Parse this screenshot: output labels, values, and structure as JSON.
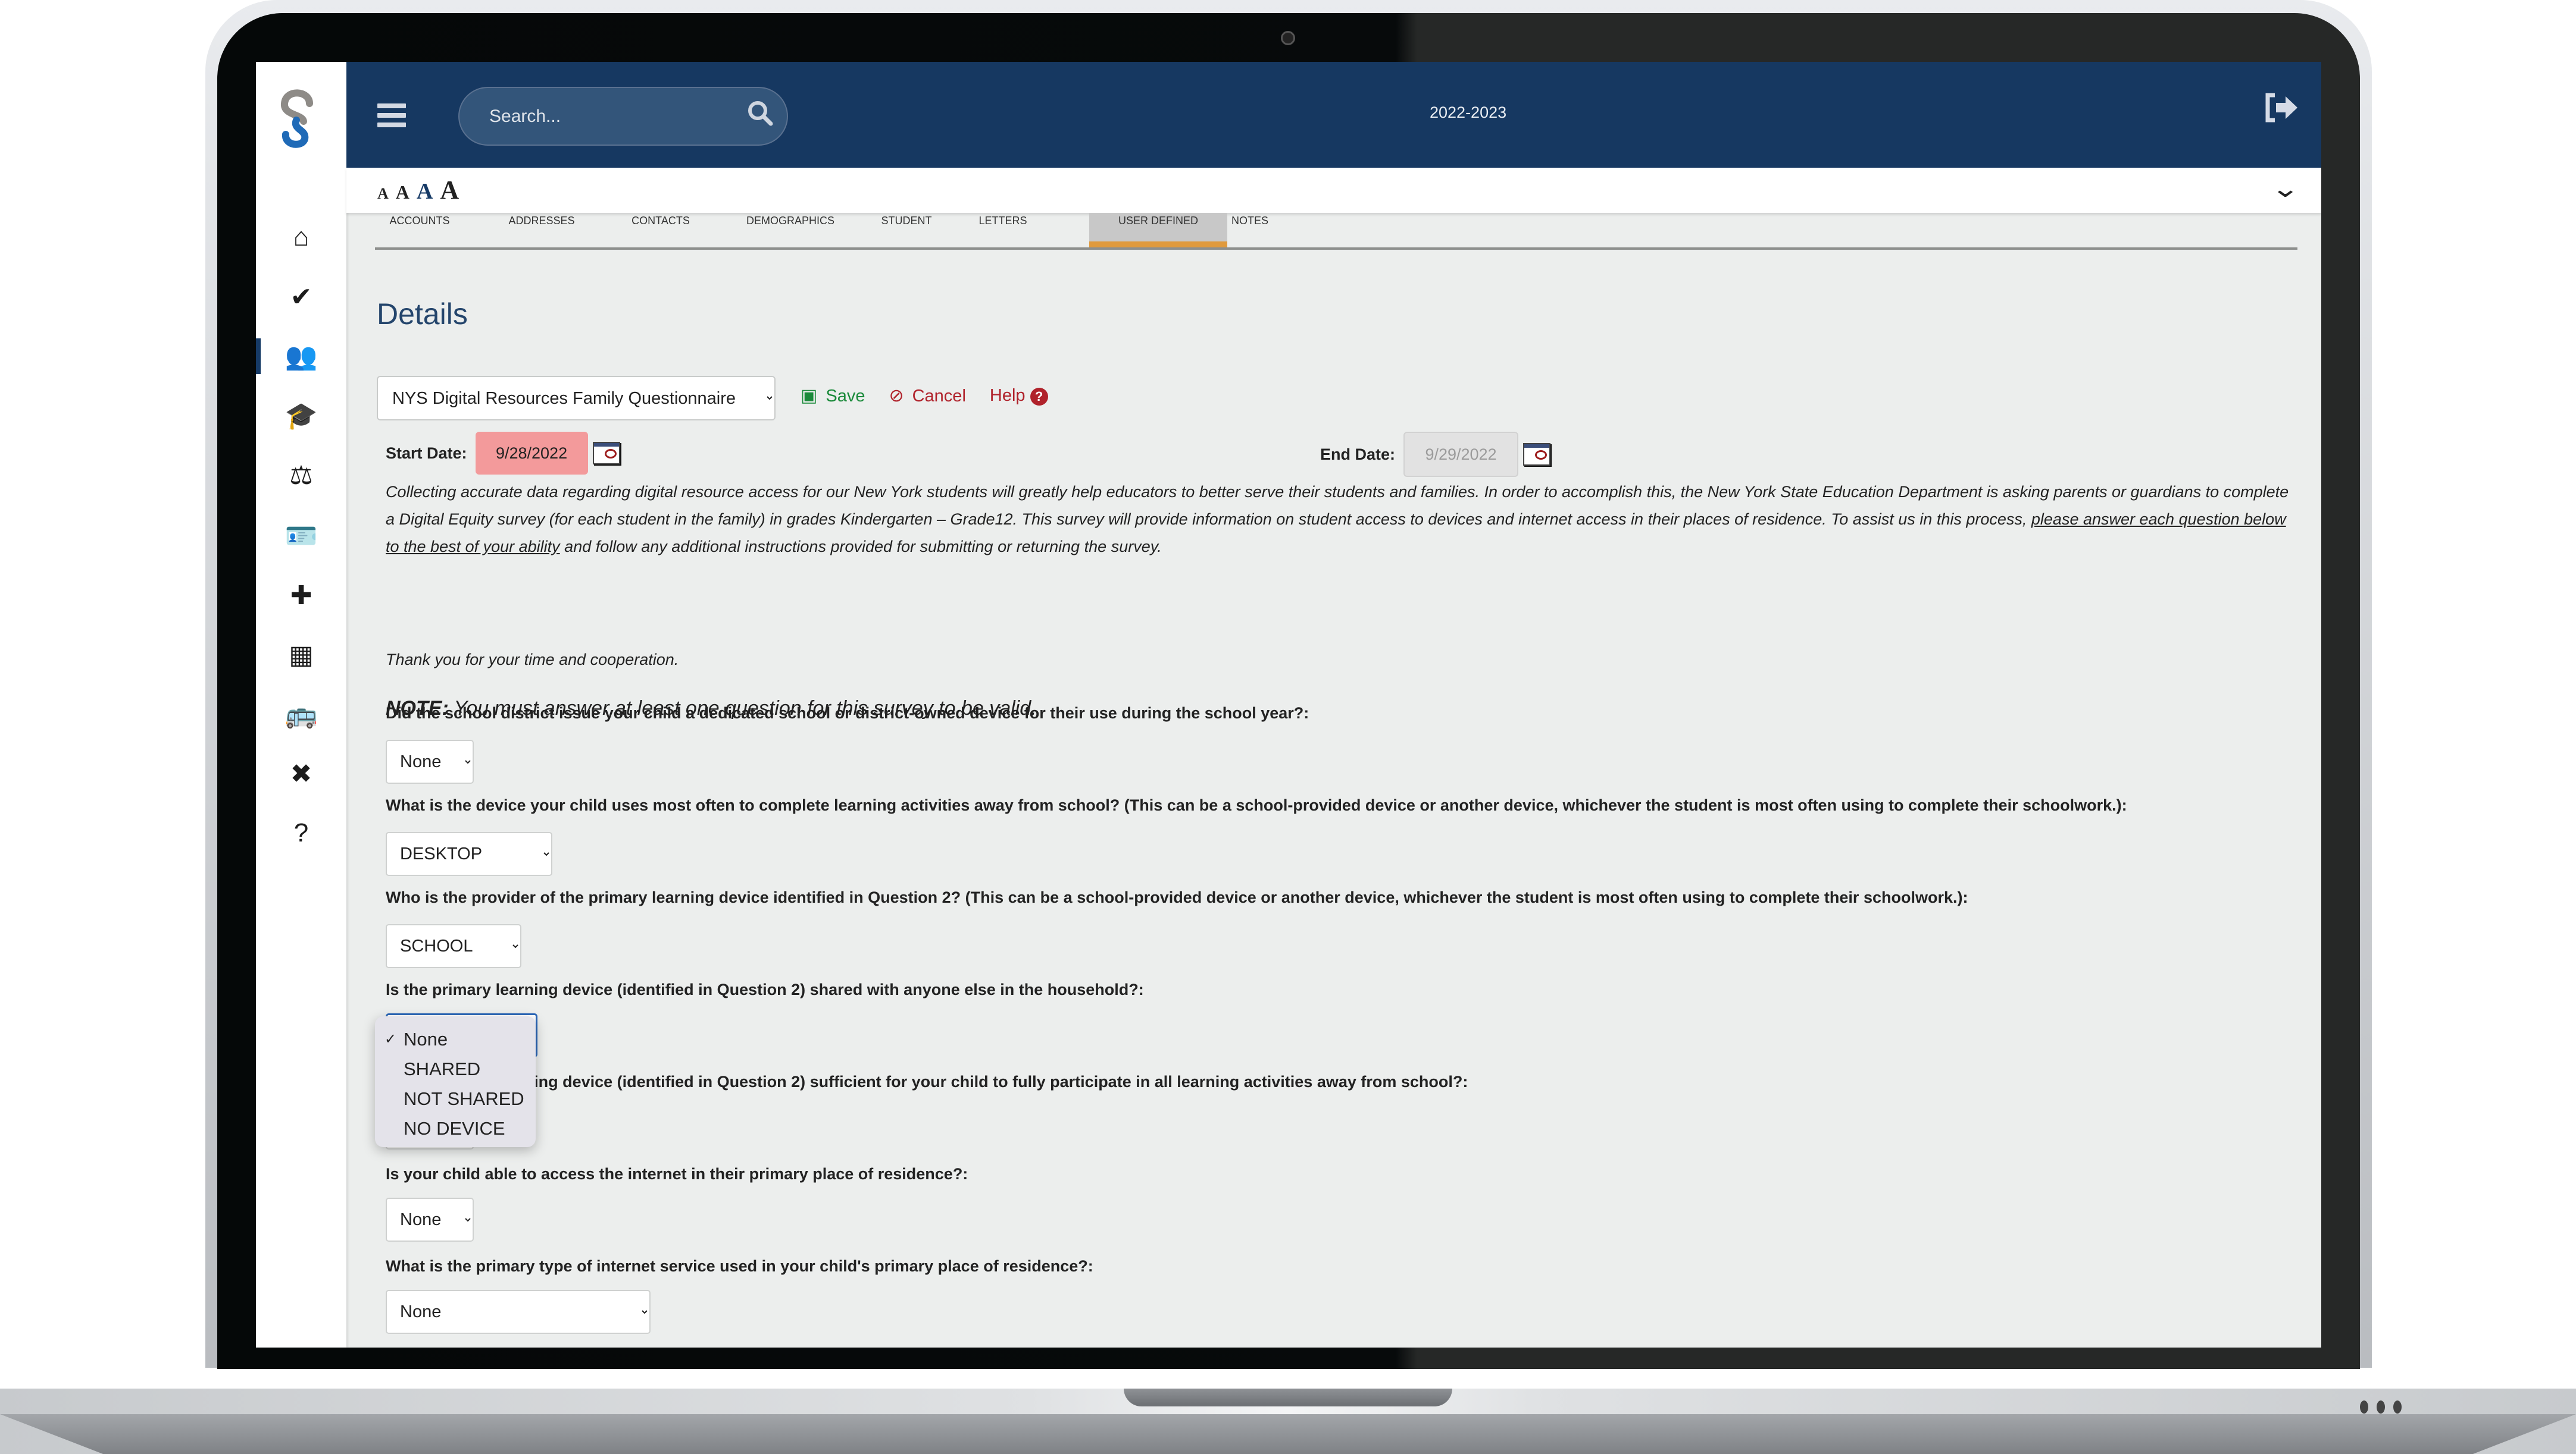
{
  "header": {
    "search_placeholder": "Search...",
    "school_year": "2022-2023"
  },
  "sidebar": {
    "items": [
      {
        "name": "home",
        "icon": "home-icon",
        "glyph": "⌂"
      },
      {
        "name": "tasks",
        "icon": "clipboard-check-icon",
        "glyph": "✔"
      },
      {
        "name": "family",
        "icon": "users-icon",
        "glyph": "👥",
        "active": true
      },
      {
        "name": "students",
        "icon": "graduate-icon",
        "glyph": "🎓"
      },
      {
        "name": "discipline",
        "icon": "balance-scale-icon",
        "glyph": "⚖"
      },
      {
        "name": "staff",
        "icon": "id-badge-icon",
        "glyph": "🪪"
      },
      {
        "name": "health",
        "icon": "medkit-icon",
        "glyph": "✚"
      },
      {
        "name": "calendar",
        "icon": "calendar-icon",
        "glyph": "▦"
      },
      {
        "name": "transportation",
        "icon": "bus-icon",
        "glyph": "🚌"
      },
      {
        "name": "tools",
        "icon": "tools-icon",
        "glyph": "✖"
      },
      {
        "name": "help",
        "icon": "question-circle-icon",
        "glyph": "?"
      }
    ]
  },
  "font_sizes": [
    "A",
    "A",
    "A",
    "A"
  ],
  "tabs": [
    {
      "label": "ACCOUNTS"
    },
    {
      "label": "ADDRESSES"
    },
    {
      "label": "CONTACTS"
    },
    {
      "label": "DEMOGRAPHICS"
    },
    {
      "label": "STUDENT"
    },
    {
      "label": "LETTERS"
    },
    {
      "label": "USER DEFINED",
      "active": true
    },
    {
      "label": "NOTES"
    }
  ],
  "details": {
    "title": "Details",
    "questionnaire_selected": "NYS Digital Resources Family Questionnaire",
    "save_label": "Save",
    "cancel_label": "Cancel",
    "help_label": "Help",
    "start_date_label": "Start Date:",
    "start_date": "9/28/2022",
    "end_date_label": "End Date:",
    "end_date": "9/29/2022",
    "intro_part1": "Collecting accurate data regarding digital resource access for our New York students will greatly help educators to better serve their students and families. In order to accomplish this, the New York State Education Department is asking parents or guardians to complete a Digital Equity survey (for each student in the family) in grades Kindergarten – Grade12. This survey will provide information on student access to devices and internet access in their places of residence. To assist us in this process, ",
    "intro_underlined": "please answer each question below to the best of your ability",
    "intro_part2": " and follow any additional instructions provided for submitting or returning the survey.",
    "thanks": "Thank you for your time and cooperation.",
    "note_prefix": "NOTE:",
    "note_text": " You must answer at least one question for this survey to be valid."
  },
  "questions": [
    {
      "text": "Did the school district issue your child a dedicated school or district-owned device for their use during the school year?:",
      "value": "None"
    },
    {
      "text": "What is the device your child uses most often to complete learning activities away from school? (This can be a school-provided device or another device, whichever the student is most often using to complete their schoolwork.):",
      "value": "DESKTOP"
    },
    {
      "text": "Who is the provider of the primary learning device identified in Question 2? (This can be a school-provided device or another device, whichever the student is most often using to complete their schoolwork.):",
      "value": "SCHOOL"
    },
    {
      "text": "Is the primary learning device (identified in Question 2) shared with anyone else in the household?:",
      "value": "None"
    },
    {
      "text": "Is the primary learning device (identified in Question 2) sufficient for your child to fully participate in all learning activities away from school?:",
      "value": "None"
    },
    {
      "text": "Is your child able to access the internet in their primary place of residence?:",
      "value": "None"
    },
    {
      "text": "What is the primary type of internet service used in your child's primary place of residence?:",
      "value": "None"
    }
  ],
  "open_dropdown": {
    "options": [
      "None",
      "SHARED",
      "NOT SHARED",
      "NO DEVICE"
    ],
    "selected": "None",
    "check_glyph": "✓"
  }
}
